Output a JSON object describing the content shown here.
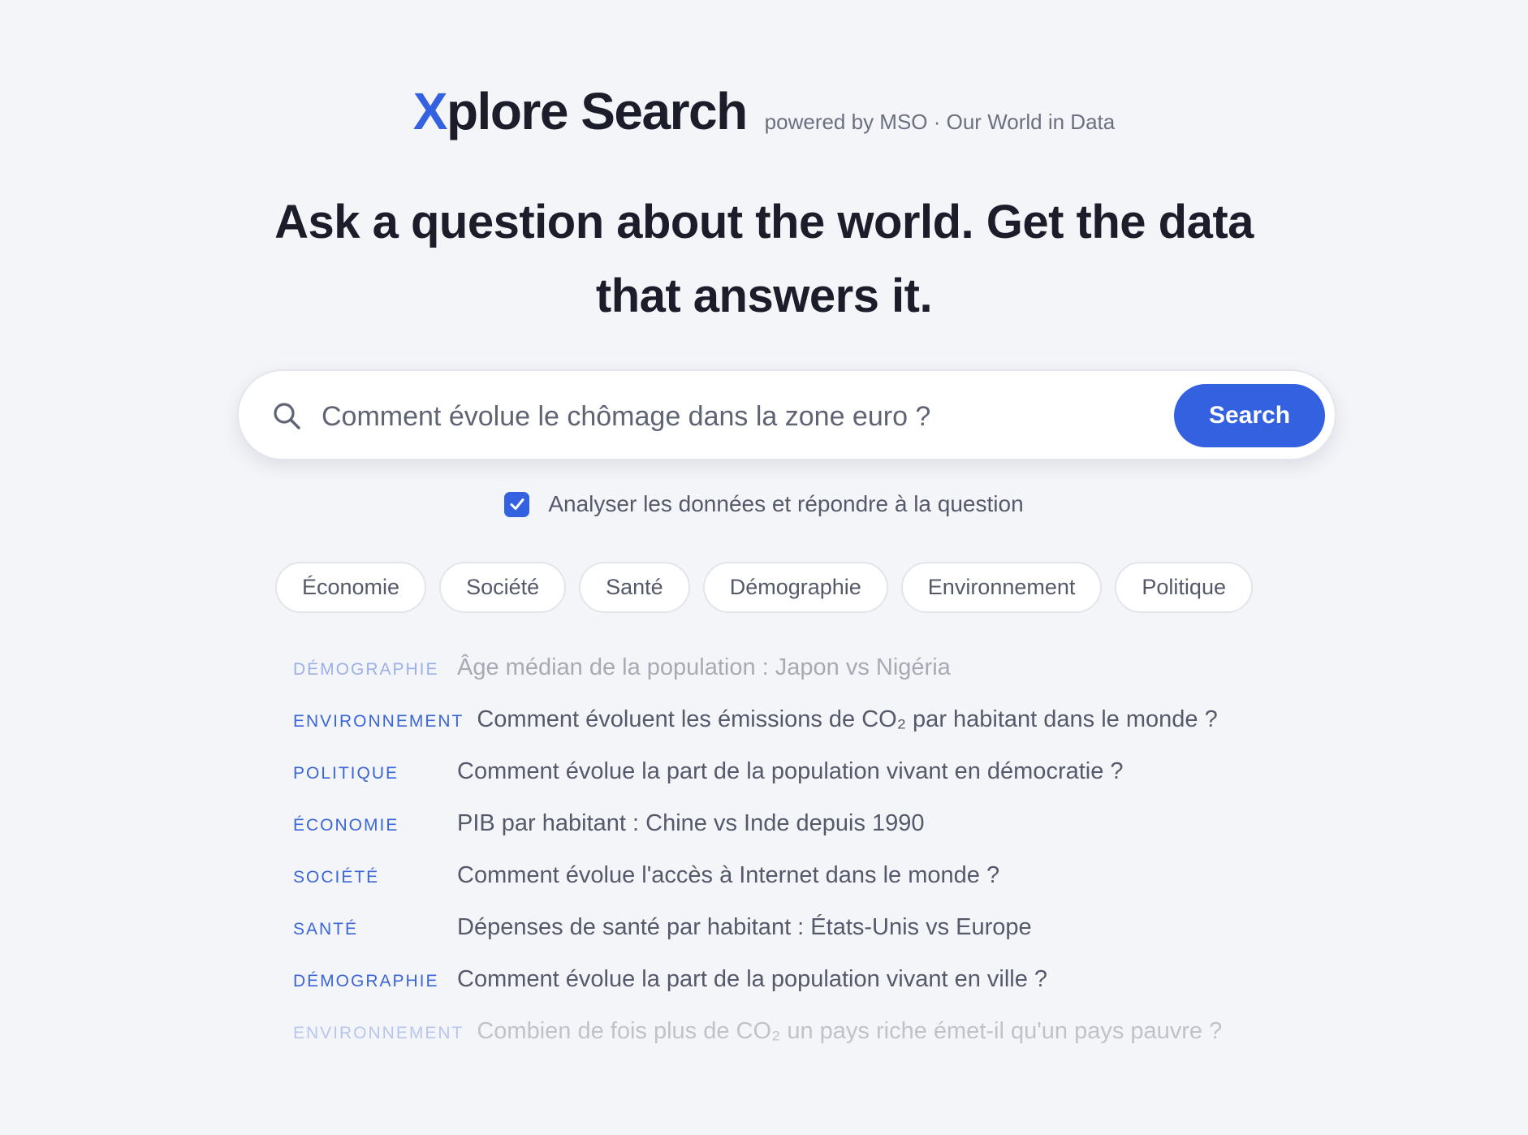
{
  "brand": {
    "logo_x": "X",
    "logo_rest": "plore Search",
    "tagline": "powered by MSO · Our World in Data"
  },
  "headline": {
    "line1": "Ask a question about the world. Get the data",
    "line2": "that answers it."
  },
  "search": {
    "placeholder": "Comment évolue le chômage dans la zone euro ?",
    "value": "",
    "button_label": "Search"
  },
  "analyze": {
    "checked": true,
    "label": "Analyser les données et répondre à la question"
  },
  "categories": [
    "Économie",
    "Société",
    "Santé",
    "Démographie",
    "Environnement",
    "Politique"
  ],
  "suggestions": [
    {
      "category": "DÉMOGRAPHIE",
      "question": "Âge médian de la population : Japon vs Nigéria"
    },
    {
      "category": "ENVIRONNEMENT",
      "question": "Comment évoluent les émissions de CO₂ par habitant dans le monde ?"
    },
    {
      "category": "POLITIQUE",
      "question": "Comment évolue la part de la population vivant en démocratie ?"
    },
    {
      "category": "ÉCONOMIE",
      "question": "PIB par habitant : Chine vs Inde depuis 1990"
    },
    {
      "category": "SOCIÉTÉ",
      "question": "Comment évolue l'accès à Internet dans le monde ?"
    },
    {
      "category": "SANTÉ",
      "question": "Dépenses de santé par habitant : États-Unis vs Europe"
    },
    {
      "category": "DÉMOGRAPHIE",
      "question": "Comment évolue la part de la population vivant en ville ?"
    },
    {
      "category": "ENVIRONNEMENT",
      "question": "Combien de fois plus de CO₂ un pays riche émet-il qu'un pays pauvre ?"
    }
  ],
  "colors": {
    "accent": "#3461e0",
    "background": "#f4f5f9",
    "text_dark": "#1b1d2b",
    "text_muted": "#555a6b"
  },
  "icons": {
    "search": "search-icon",
    "check": "check-icon"
  }
}
